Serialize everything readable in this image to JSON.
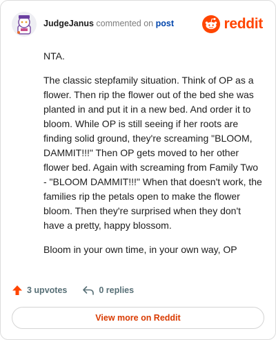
{
  "header": {
    "author": "JudgeJanus",
    "verb": "commented on",
    "post_link": "post",
    "logo_text": "reddit",
    "avatar_icon": "snoo-avatar-icon",
    "logo_icon": "reddit-snoo-icon"
  },
  "comment": {
    "paragraphs": [
      "NTA.",
      "The classic stepfamily situation. Think of OP as a flower. Then rip the flower out of the bed she was planted in and put it in a new bed. And order it to bloom. While OP is still seeing if her roots are finding solid ground, they're screaming \"BLOOM, DAMMIT!!!\" Then OP gets moved to her other flower bed. Again with screaming from Family Two - \"BLOOM DAMMIT!!!\" When that doesn't work, the families rip the petals open to make the flower bloom. Then they're surprised when they don't have a pretty, happy blossom.",
      "Bloom in your own time, in your own way, OP"
    ]
  },
  "actions": {
    "upvotes": "3 upvotes",
    "replies": "0 replies",
    "upvote_icon": "upvote-arrow-icon",
    "reply_icon": "reply-arrow-icon"
  },
  "footer": {
    "view_more": "View more on Reddit"
  },
  "colors": {
    "brand": "#ff4500",
    "link": "#0045ac",
    "view_more": "#d93a00",
    "muted": "#576f76"
  }
}
